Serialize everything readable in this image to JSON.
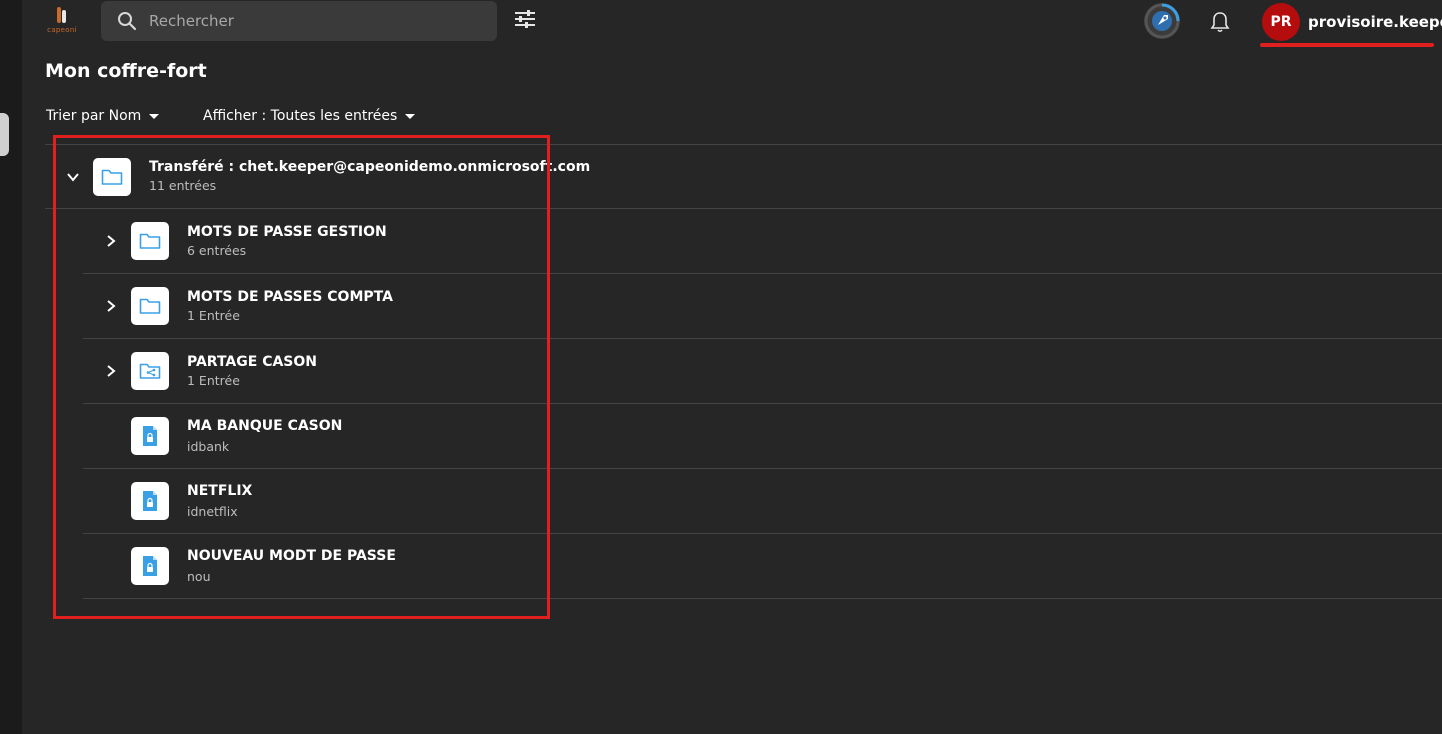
{
  "header": {
    "logo_text": "capeoni",
    "search_placeholder": "Rechercher",
    "user_initials": "PR",
    "username": "provisoire.keeper@",
    "colors": {
      "accent": "#3aa0e6",
      "avatar": "#b50d0d",
      "annotation": "#e01f1f"
    }
  },
  "page": {
    "title": "Mon coffre-fort",
    "sort_label": "Trier par Nom",
    "view_label": "Afficher : Toutes les entrées"
  },
  "tree": {
    "root": {
      "title": "Transféré : chet.keeper@capeonidemo.onmicrosoft.com",
      "subtitle": "11 entrées",
      "icon": "folder-icon",
      "expanded": true
    },
    "items": [
      {
        "title": "MOTS DE PASSE GESTION",
        "subtitle": "6 entrées",
        "icon": "folder-icon"
      },
      {
        "title": "MOTS DE PASSES COMPTA",
        "subtitle": "1 Entrée",
        "icon": "folder-icon"
      },
      {
        "title": "PARTAGE CASON",
        "subtitle": "1 Entrée",
        "icon": "shared-folder-icon"
      },
      {
        "title": "MA BANQUE CASON",
        "subtitle": "idbank",
        "icon": "password-record-icon"
      },
      {
        "title": "NETFLIX",
        "subtitle": "idnetflix",
        "icon": "password-record-icon"
      },
      {
        "title": "NOUVEAU MODT DE PASSE",
        "subtitle": "nou",
        "icon": "password-record-icon"
      }
    ]
  }
}
